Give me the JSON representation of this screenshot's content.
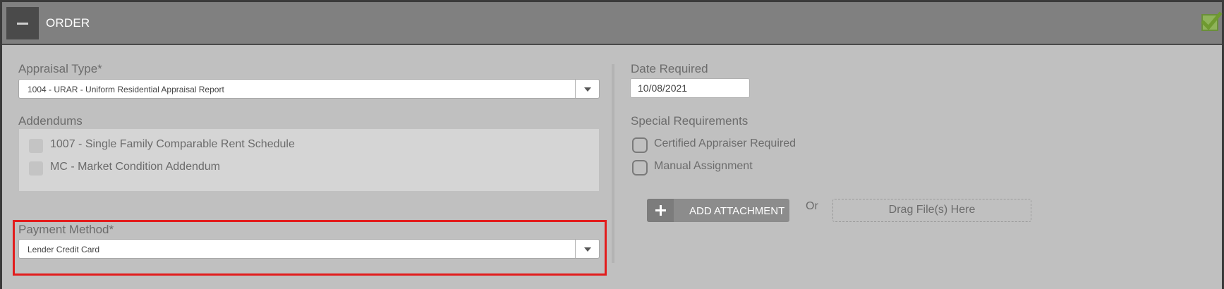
{
  "header": {
    "title": "ORDER"
  },
  "appraisal_type": {
    "label": "Appraisal Type*",
    "value": "1004 - URAR - Uniform Residential Appraisal Report"
  },
  "addendums": {
    "label": "Addendums",
    "items": [
      {
        "label": "1007 - Single Family Comparable Rent Schedule"
      },
      {
        "label": "MC - Market Condition Addendum"
      }
    ]
  },
  "payment_method": {
    "label": "Payment Method*",
    "value": "Lender Credit Card"
  },
  "date_required": {
    "label": "Date Required",
    "value": "10/08/2021"
  },
  "special_requirements": {
    "label": "Special Requirements",
    "items": [
      {
        "label": "Certified Appraiser Required"
      },
      {
        "label": "Manual Assignment"
      }
    ]
  },
  "attachments": {
    "add_label": "ADD ATTACHMENT",
    "or_label": "Or",
    "drop_label": "Drag File(s) Here"
  },
  "colors": {
    "header_bg": "#808080",
    "panel_bg": "#c0c0c0",
    "highlight": "#e21c1c",
    "check": "#8fb35a"
  },
  "icons": {
    "collapse": "minus-icon",
    "complete": "check-icon",
    "dropdown": "chevron-down-icon",
    "attach": "plus-icon"
  }
}
